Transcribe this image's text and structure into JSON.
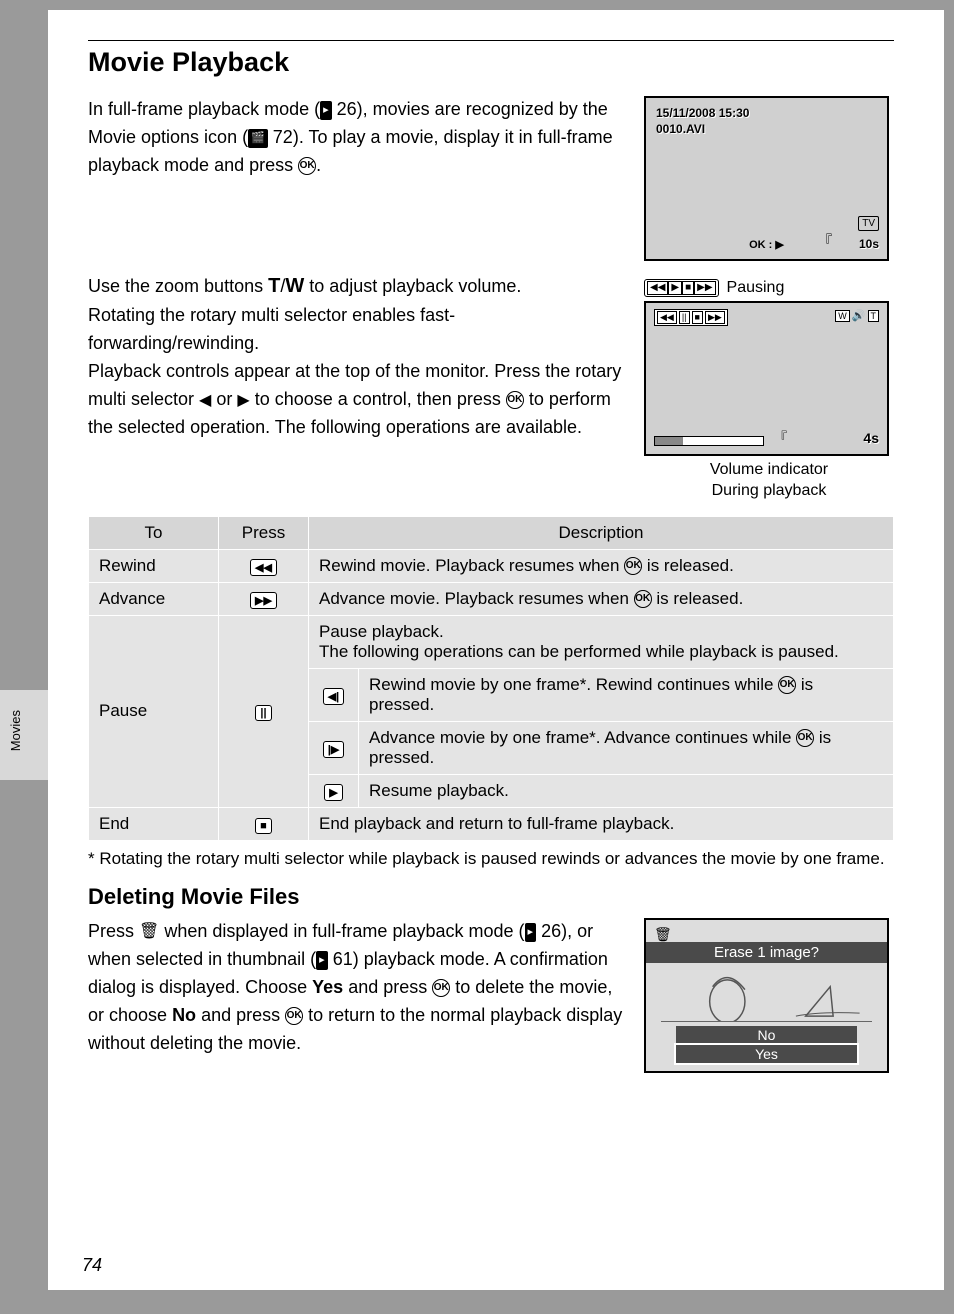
{
  "sideLabel": "Movies",
  "h1": "Movie Playback",
  "intro": {
    "pre1": "In full-frame playback mode (",
    "ref1": "26",
    "mid1": "), movies are recognized by the Movie options icon (",
    "ref2": "72",
    "post1": "). To play a movie, display it in full-frame playback mode and press ",
    "post2": "."
  },
  "okLabel": "OK",
  "zoomPara": {
    "pre": "Use the zoom buttons ",
    "t": "T",
    "slash": "/",
    "w": "W",
    "post": " to adjust playback volume."
  },
  "rotatePara": "Rotating the rotary multi selector enables fast-forwarding/rewinding.",
  "controlsPara": {
    "l1": "Playback controls appear at the top of the monitor. Press the rotary multi selector ",
    "or": " or ",
    "l2": " to choose a control, then press ",
    "l3": " to perform the selected operation. The following operations are available."
  },
  "screen1": {
    "timestamp": "15/11/2008 15:30",
    "filename": "0010.AVI",
    "tv": "TV",
    "okplay": "OK : ▶",
    "duration": "10s"
  },
  "pausingLabel": "Pausing",
  "screen2": {
    "t4s": "4s"
  },
  "caption": {
    "l1": "Volume indicator",
    "l2": "During playback"
  },
  "table": {
    "headers": {
      "to": "To",
      "press": "Press",
      "desc": "Description"
    },
    "rewind": {
      "to": "Rewind",
      "desc_pre": "Rewind movie. Playback resumes when ",
      "desc_post": " is released."
    },
    "advance": {
      "to": "Advance",
      "desc_pre": "Advance movie. Playback resumes when ",
      "desc_post": " is released."
    },
    "pause": {
      "to": "Pause",
      "desc1": "Pause playback.\nThe following operations can be performed while playback is paused.",
      "sub1_pre": "Rewind movie by one frame*. Rewind continues while ",
      "sub1_post": " is pressed.",
      "sub2_pre": "Advance movie by one frame*. Advance continues while ",
      "sub2_post": " is pressed.",
      "sub3": "Resume playback."
    },
    "end": {
      "to": "End",
      "desc": "End playback and return to full-frame playback."
    }
  },
  "footnote": "*  Rotating the rotary multi selector while playback is paused rewinds or advances the movie by one frame.",
  "h2": "Deleting Movie Files",
  "delete": {
    "pre": "Press ",
    "mid1": " when displayed in full-frame playback mode (",
    "ref1": "26",
    "mid2": "), or when selected in thumbnail (",
    "ref2": "61",
    "mid3": ") playback mode. A confirmation dialog is displayed. Choose ",
    "yes": "Yes",
    "mid4": " and press ",
    "mid5": " to delete the movie, or choose ",
    "no": "No",
    "mid6": " and press ",
    "mid7": " to return to the normal playback display without deleting the movie."
  },
  "screen3": {
    "question": "Erase 1 image?",
    "no": "No",
    "yes": "Yes"
  },
  "pageNumber": "74"
}
